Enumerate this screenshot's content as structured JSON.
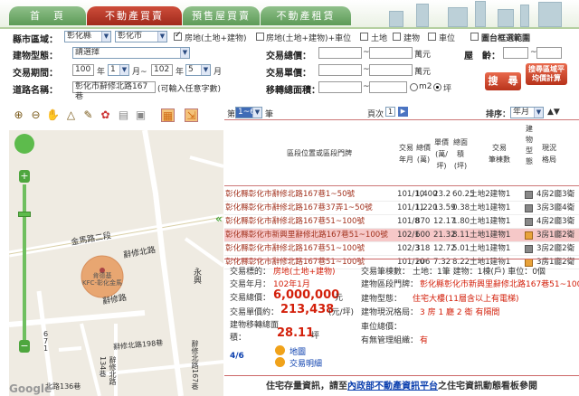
{
  "nav": {
    "tabs": [
      {
        "label": "首　頁"
      },
      {
        "label": "不動產買賣"
      },
      {
        "label": "預售屋買賣"
      },
      {
        "label": "不動產租賃"
      }
    ]
  },
  "search": {
    "county_label": "縣市區域：",
    "county_value": "彰化縣",
    "city_value": "彰化市",
    "type_options": [
      "房地(土地+建物)",
      "房地(土地+建物)+車位",
      "土地",
      "建物",
      "車位"
    ],
    "map_range_label": "圖台框選範圍",
    "building_type_label": "建物型態：",
    "building_type_value": "請選擇",
    "total_price_label": "交易總價：",
    "total_price_unit": "萬元",
    "age_label": "屋　齡：",
    "period_label": "交易期間：",
    "from_year": "100",
    "year_text": "年",
    "from_month": "1",
    "month_to_text": "月~",
    "to_year": "102",
    "to_month": "5",
    "month_text": "月",
    "unit_price_label": "交易單價：",
    "unit_price_unit": "萬元",
    "road_label": "道路名稱：",
    "road_value": "彰化市辭修北路167巷",
    "road_hint": "(可輸入任意字數)",
    "area_label": "移轉總面積：",
    "unit_m2": "m2",
    "unit_ping": "坪",
    "search_button": "搜　尋",
    "calc_button": "搜尋區域平均價計算"
  },
  "map": {
    "zoom_plus": "+",
    "zoom_minus": "−",
    "road_jinma": "金馬路二段",
    "road_cixiu": "辭修北路",
    "road_cixiu_2": "辭修路",
    "road_yongxing": "永興",
    "road_198": "辭修北路198巷",
    "road_167": "辭修北路167巷",
    "road_134": "辭修北路134巷",
    "road_136": "北路136巷",
    "road_lane_671": "6\n7\n1",
    "poi_label": "肯德基\nKFC-彰化金馬",
    "google_label": "Google",
    "collapse_label": "«"
  },
  "results": {
    "page_prefix": "第",
    "page_value": "1~6",
    "page_suffix": "筆",
    "page_info_label": "頁次",
    "page_current": "1",
    "page_next": "▶",
    "sort_label": "排序：",
    "sort_value": "年月",
    "sort_arrows": "▲▼",
    "headers": {
      "location": "區段位置或區段門牌",
      "date": "交易\n年月",
      "total": "總價\n(萬)",
      "unit": "單價\n(萬/\n坪)",
      "area": "總面\n積\n(坪)",
      "tx_type": "交易\n筆棟數",
      "b_type": "建\n物\n型\n態",
      "layout": "現況\n格局"
    },
    "rows": [
      {
        "addr": "彰化縣彰化市辭修北路167巷1~50號",
        "ym": "101/10",
        "amt": "1,400",
        "unit": "23.2",
        "area": "60.25",
        "type": "土地2建物1",
        "icon": "g",
        "layout": "4房2廳3衛",
        "hl": false
      },
      {
        "addr": "彰化縣彰化市辭修北路167巷37弄1~50號",
        "ym": "101/11",
        "amt": "1,220",
        "unit": "13.59",
        "area": "0.38",
        "type": "土地1建物1",
        "icon": "g",
        "layout": "3房3廳4衛",
        "hl": false
      },
      {
        "addr": "彰化縣彰化市辭修北路167巷51~100號",
        "ym": "101/8",
        "amt": "870",
        "unit": "12.17",
        "area": "1.80",
        "type": "土地1建物1",
        "icon": "g",
        "layout": "4房2廳3衛",
        "hl": false
      },
      {
        "addr": "彰化縣彰化市新興里辭修北路167巷51~100號",
        "ym": "102/1",
        "amt": "600",
        "unit": "21.32",
        "area": "8.11",
        "type": "土地1建物1",
        "icon": "y",
        "layout": "3房1廳2衛",
        "hl": true
      },
      {
        "addr": "彰化縣彰化市辭修北路167巷51~100號",
        "ym": "102/3",
        "amt": "318",
        "unit": "12.72",
        "area": "5.01",
        "type": "土地1建物1",
        "icon": "g",
        "layout": "3房2廳2衛",
        "hl": false
      },
      {
        "addr": "彰化縣彰化市辭修北路167巷51~100號",
        "ym": "101/10",
        "amt": "206",
        "unit": "7.32",
        "area": "8.22",
        "type": "土地1建物1",
        "icon": "y",
        "layout": "3房1廳2衛",
        "hl": false
      }
    ],
    "detail": {
      "tx_target_label": "交易標的：",
      "tx_target": "房地(土地+建物)",
      "tx_ym_label": "交易年月：",
      "tx_ym": "102年1月",
      "total_label": "交易總價：",
      "total_value": "6,000,000",
      "total_unit": "元",
      "unitprice_label": "交易單價約：",
      "unitprice_value": "213,438",
      "unitprice_unit": "(元/坪)",
      "area_label": "建物移轉總面\n積：",
      "area_value": "28.11",
      "area_unit": "坪",
      "count_label": "交易筆棟數：",
      "count_value": "土地：1筆 建物：1棟(戶) 車位：0個",
      "addr_label": "建物區段門牌：",
      "addr_value": "彰化縣彰化市新興里辭修北路167巷51~100號",
      "btype_label": "建物型態：",
      "btype_value": "住宅大樓(11層含以上有電梯)",
      "layout_label": "建物現況格局：",
      "layout_value": "3 房 1 廳 2 衛 有隔間",
      "parking_label": "車位總價：",
      "parking_value": "",
      "mgmt_label": "有無管理組織：",
      "mgmt_value": "有",
      "index_label": "4/6",
      "map_link": "地圖",
      "detail_link": "交易明細"
    },
    "footer_prefix": "住宅存量資訊，請至",
    "footer_link": "內政部不動產資訊平台",
    "footer_suffix": "之住宅資訊動態看板參閱"
  }
}
